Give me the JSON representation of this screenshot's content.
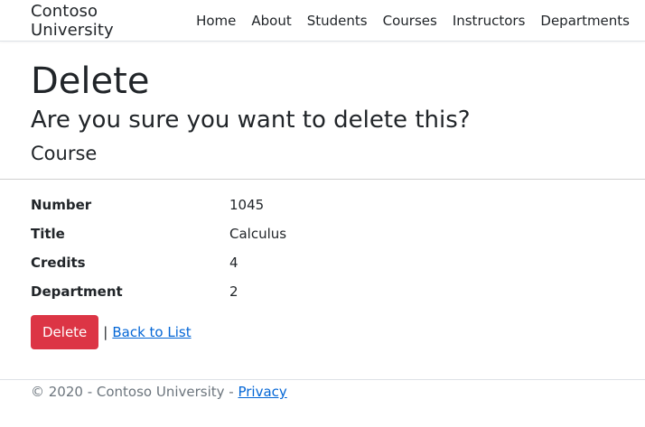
{
  "navbar": {
    "brand": "Contoso University",
    "items": [
      {
        "label": "Home"
      },
      {
        "label": "About"
      },
      {
        "label": "Students"
      },
      {
        "label": "Courses"
      },
      {
        "label": "Instructors"
      },
      {
        "label": "Departments"
      }
    ]
  },
  "page": {
    "title": "Delete",
    "confirm": "Are you sure you want to delete this?",
    "entity": "Course"
  },
  "details": [
    {
      "label": "Number",
      "value": "1045"
    },
    {
      "label": "Title",
      "value": "Calculus"
    },
    {
      "label": "Credits",
      "value": "4"
    },
    {
      "label": "Department",
      "value": "2"
    }
  ],
  "actions": {
    "delete_label": "Delete",
    "separator": "|",
    "back_label": "Back to List"
  },
  "footer": {
    "text": "© 2020 - Contoso University - ",
    "privacy_label": "Privacy"
  },
  "colors": {
    "danger": "#dc3545",
    "link": "#0366d6",
    "muted": "#6c757d"
  }
}
